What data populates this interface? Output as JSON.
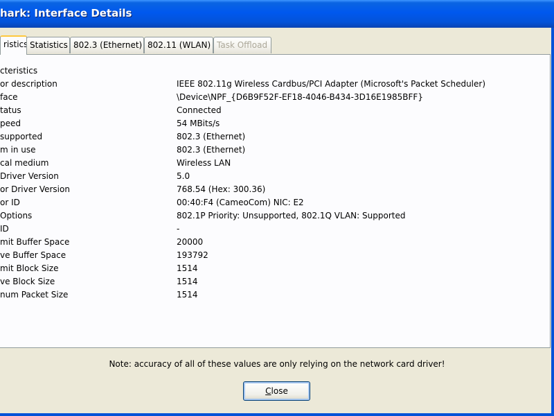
{
  "window": {
    "title": "hark: Interface Details"
  },
  "tabs": [
    {
      "label": "ristics",
      "active": true,
      "disabled": false
    },
    {
      "label": "Statistics",
      "active": false,
      "disabled": false
    },
    {
      "label": "802.3 (Ethernet)",
      "active": false,
      "disabled": false
    },
    {
      "label": "802.11 (WLAN)",
      "active": false,
      "disabled": false
    },
    {
      "label": "Task Offload",
      "active": false,
      "disabled": true
    }
  ],
  "panel": {
    "rows": [
      {
        "label": "cteristics",
        "value": ""
      },
      {
        "label": "or description",
        "value": "IEEE 802.11g Wireless Cardbus/PCI Adapter (Microsoft's Packet Scheduler)"
      },
      {
        "label": "face",
        "value": "\\Device\\NPF_{D6B9F52F-EF18-4046-B434-3D16E1985BFF}"
      },
      {
        "label": "tatus",
        "value": "Connected"
      },
      {
        "label": "peed",
        "value": "54 MBits/s"
      },
      {
        "label": "supported",
        "value": "802.3 (Ethernet)"
      },
      {
        "label": "m in use",
        "value": "802.3 (Ethernet)"
      },
      {
        "label": "cal medium",
        "value": "Wireless LAN"
      },
      {
        "label": "Driver Version",
        "value": "5.0"
      },
      {
        "label": "or Driver Version",
        "value": "768.54 (Hex: 300.36)"
      },
      {
        "label": "or ID",
        "value": "00:40:F4 (CameoCom) NIC: E2"
      },
      {
        "label": "Options",
        "value": "802.1P Priority: Unsupported, 802.1Q VLAN: Supported"
      },
      {
        "label": "ID",
        "value": "-"
      },
      {
        "label": "mit Buffer Space",
        "value": "20000"
      },
      {
        "label": "ve Buffer Space",
        "value": "193792"
      },
      {
        "label": "mit Block Size",
        "value": "1514"
      },
      {
        "label": "ve Block Size",
        "value": "1514"
      },
      {
        "label": "num Packet Size",
        "value": "1514"
      }
    ]
  },
  "footer": {
    "note": "Note: accuracy of all of these values are only relying on the network card driver!",
    "close_mnemonic": "C",
    "close_rest": "lose"
  },
  "colors": {
    "titlebar_blue": "#0058ee",
    "window_face": "#ece9d8",
    "panel_face": "#fcfcfe",
    "active_tab_accent": "#ffc83c",
    "disabled_text": "#aca899"
  }
}
